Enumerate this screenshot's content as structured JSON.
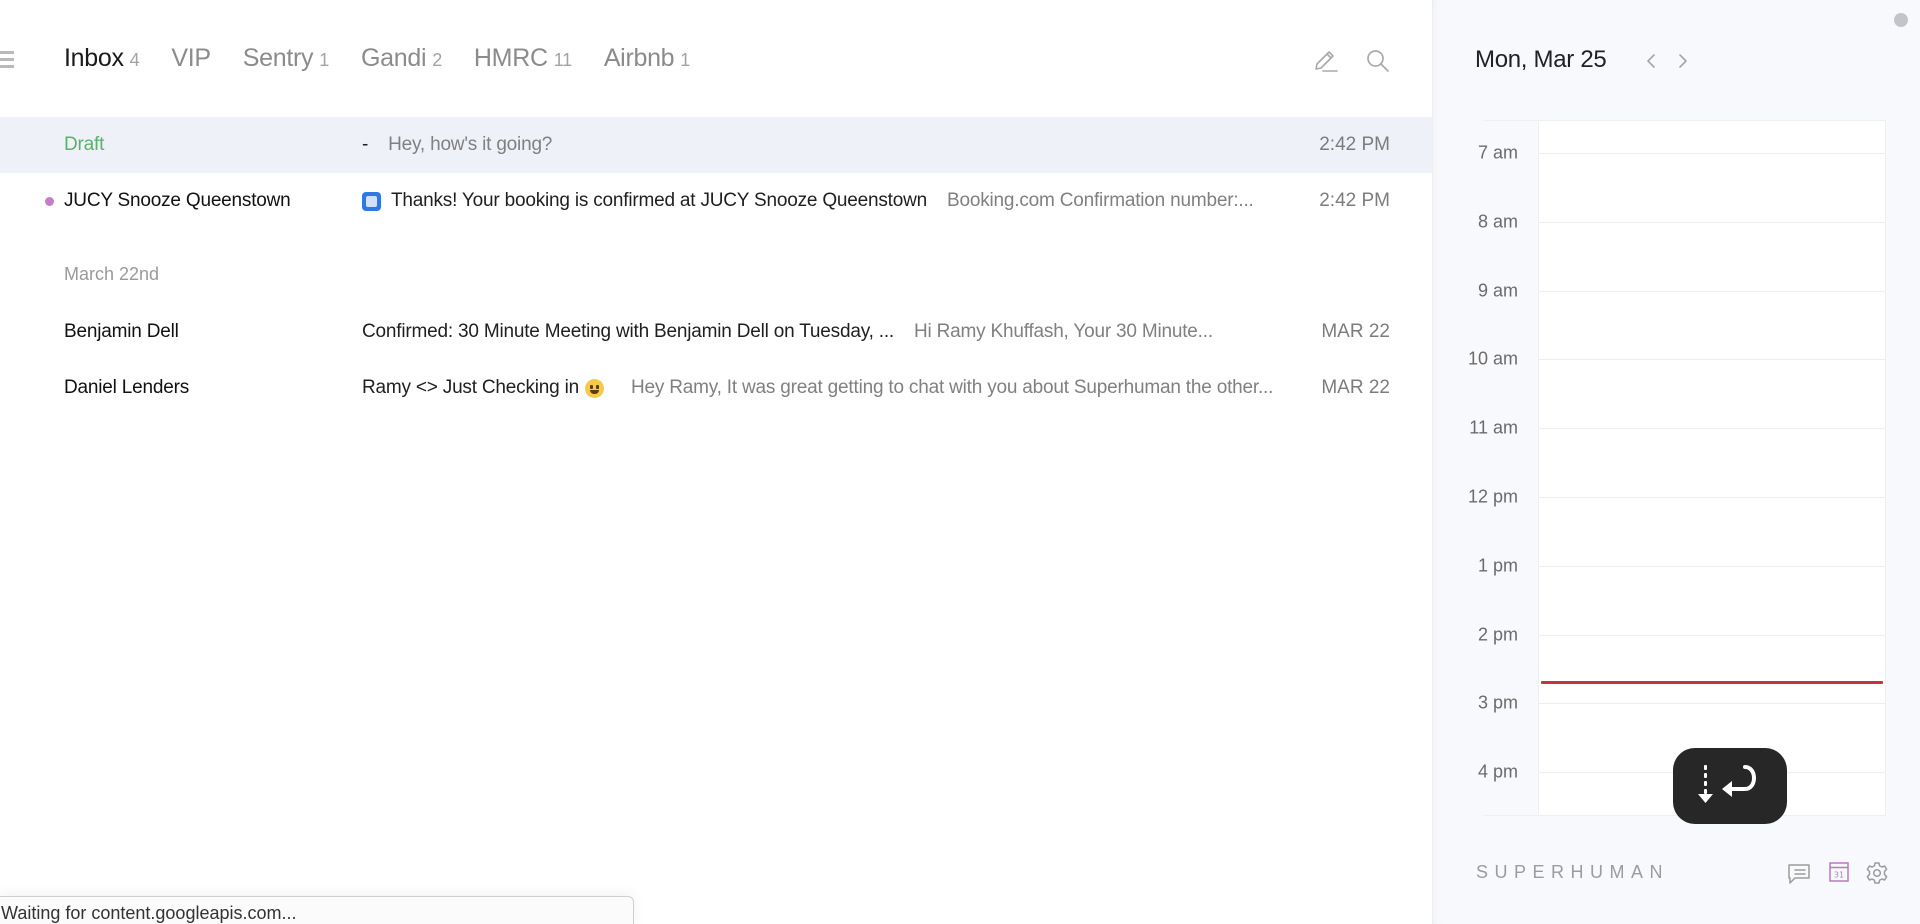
{
  "tabs": [
    {
      "label": "Inbox",
      "count": "4",
      "active": true
    },
    {
      "label": "VIP",
      "count": "",
      "active": false
    },
    {
      "label": "Sentry",
      "count": "1",
      "active": false
    },
    {
      "label": "Gandi",
      "count": "2",
      "active": false
    },
    {
      "label": "HMRC",
      "count": "11",
      "active": false
    },
    {
      "label": "Airbnb",
      "count": "1",
      "active": false
    }
  ],
  "toolbar": {
    "compose_icon": "pencil-icon",
    "search_icon": "search-icon",
    "menu_icon": "hamburger-icon"
  },
  "threads_today": [
    {
      "sender": "Draft",
      "is_draft": true,
      "prefix": "-",
      "subject": "",
      "snippet": "Hey, how's it going?",
      "time": "2:42 PM",
      "selected": true
    },
    {
      "sender": "JUCY Snooze Queenstown",
      "unread": true,
      "unread_dot_color": "#c77dc5",
      "subject_icon": "app-icon",
      "subject": "Thanks! Your booking is confirmed at JUCY Snooze Queenstown",
      "snippet": "Booking.com Confirmation number:...",
      "time": "2:42 PM"
    }
  ],
  "group_label": "March 22nd",
  "threads_earlier": [
    {
      "sender": "Benjamin Dell",
      "subject": "Confirmed: 30 Minute Meeting with Benjamin Dell on Tuesday, ...",
      "snippet": "Hi Ramy Khuffash, Your 30 Minute...",
      "time": "MAR 22"
    },
    {
      "sender": "Daniel Lenders",
      "subject": "Ramy <> Just Checking in",
      "subject_emoji": "grinning-face",
      "snippet": "Hey Ramy, It was great getting to chat with you about Superhuman the other...",
      "time": "MAR 22"
    }
  ],
  "status_bar": "Waiting for content.googleapis.com...",
  "calendar": {
    "date": "Mon, Mar 25",
    "hours": [
      "7 am",
      "8 am",
      "9 am",
      "10 am",
      "11 am",
      "12 pm",
      "1 pm",
      "2 pm",
      "3 pm",
      "4 pm"
    ],
    "first_hour": 7,
    "now_time": "2:42 PM",
    "now_hour_decimal": 14.7,
    "now_line_color": "#c8323f",
    "events": []
  },
  "footer": {
    "brand": "SUPERHUMAN",
    "calendar_day": "31",
    "accent_color": "#b57bc0"
  }
}
